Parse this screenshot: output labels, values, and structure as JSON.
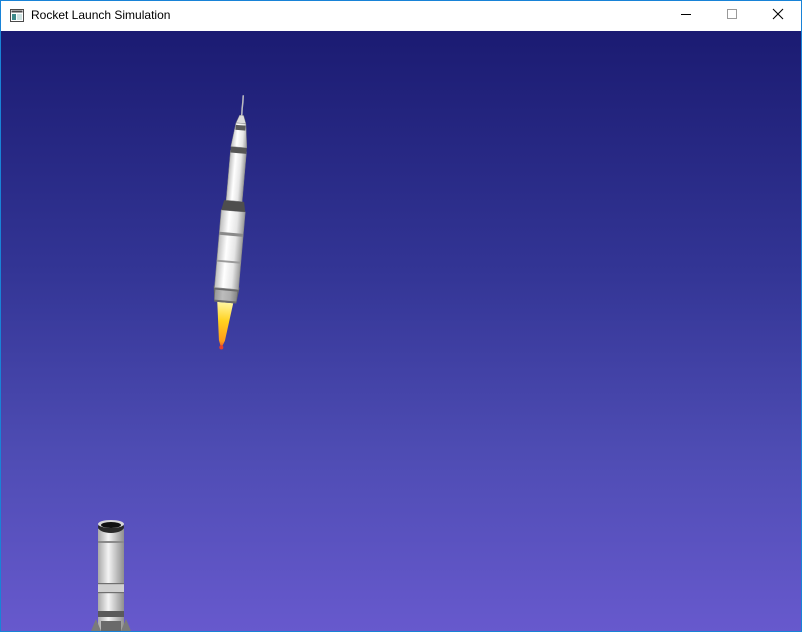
{
  "window": {
    "title": "Rocket Launch Simulation"
  },
  "titlebar": {
    "icon": "app-window-icon",
    "buttons": {
      "minimize": "minimize-icon",
      "maximize": "maximize-icon",
      "close": "close-icon"
    }
  },
  "scene": {
    "sky_top_color": "#1b1b72",
    "sky_bottom_color": "#6759cd",
    "rocket_body_color": "#f2f2f2",
    "rocket_band_color": "#505050",
    "flame_color": "#ffcc22"
  }
}
